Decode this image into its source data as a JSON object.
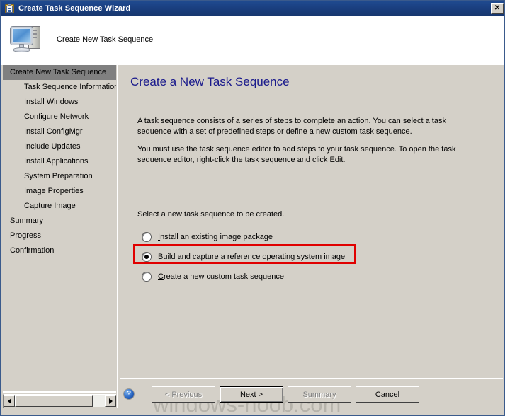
{
  "window": {
    "title": "Create Task Sequence Wizard",
    "title_icon": "clipboard-checklist-icon",
    "close_label": "✕",
    "title_bar_color": "#1a3f80",
    "face_color": "#d4d0c8"
  },
  "header": {
    "title": "Create New Task Sequence",
    "icon": "computer-icon"
  },
  "sidebar": {
    "items": [
      {
        "label": "Create New Task Sequence",
        "level": 0,
        "selected": true
      },
      {
        "label": "Task Sequence Information",
        "level": 1,
        "selected": false
      },
      {
        "label": "Install Windows",
        "level": 1,
        "selected": false
      },
      {
        "label": "Configure Network",
        "level": 1,
        "selected": false
      },
      {
        "label": "Install ConfigMgr",
        "level": 1,
        "selected": false
      },
      {
        "label": "Include Updates",
        "level": 1,
        "selected": false
      },
      {
        "label": "Install Applications",
        "level": 1,
        "selected": false
      },
      {
        "label": "System Preparation",
        "level": 1,
        "selected": false
      },
      {
        "label": "Image Properties",
        "level": 1,
        "selected": false
      },
      {
        "label": "Capture Image",
        "level": 1,
        "selected": false
      },
      {
        "label": "Summary",
        "level": 0,
        "selected": false
      },
      {
        "label": "Progress",
        "level": 0,
        "selected": false
      },
      {
        "label": "Confirmation",
        "level": 0,
        "selected": false
      }
    ],
    "scrollbar": {
      "left_arrow": "◄",
      "right_arrow": "►"
    }
  },
  "content": {
    "heading": "Create a New Task Sequence",
    "heading_color": "#1a1a8c",
    "paragraph_1": "A task sequence consists of a series of steps to complete an action. You can select a task sequence with a set of predefined steps or define a new custom task sequence.",
    "paragraph_2": "You must use the task sequence editor to add steps to your task sequence. To open the task sequence editor, right-click the task sequence and click Edit.",
    "select_label": "Select a new task sequence to be created.",
    "options": [
      {
        "accesskey": "I",
        "before": "",
        "after": "nstall an existing image package",
        "full_label": "Install an existing image package",
        "selected": false
      },
      {
        "accesskey": "B",
        "before": "",
        "after": "uild and capture a reference operating system image",
        "full_label": "Build and capture a reference operating system image",
        "selected": true
      },
      {
        "accesskey": "C",
        "before": "",
        "after": "reate a new custom task sequence",
        "full_label": "Create a new custom task sequence",
        "selected": false
      }
    ],
    "highlight": {
      "target_option_index": 1,
      "color": "#e00000"
    }
  },
  "footer": {
    "help_icon": "help-question-icon",
    "help_glyph": "?",
    "watermark": "windows-noob.com",
    "buttons": [
      {
        "label": "< Previous",
        "name": "previous-button",
        "disabled": true,
        "default": false
      },
      {
        "label": "Next >",
        "name": "next-button",
        "disabled": false,
        "default": true
      },
      {
        "label": "Summary",
        "name": "summary-button",
        "disabled": true,
        "default": false
      },
      {
        "label": "Cancel",
        "name": "cancel-button",
        "disabled": false,
        "default": false
      }
    ]
  }
}
